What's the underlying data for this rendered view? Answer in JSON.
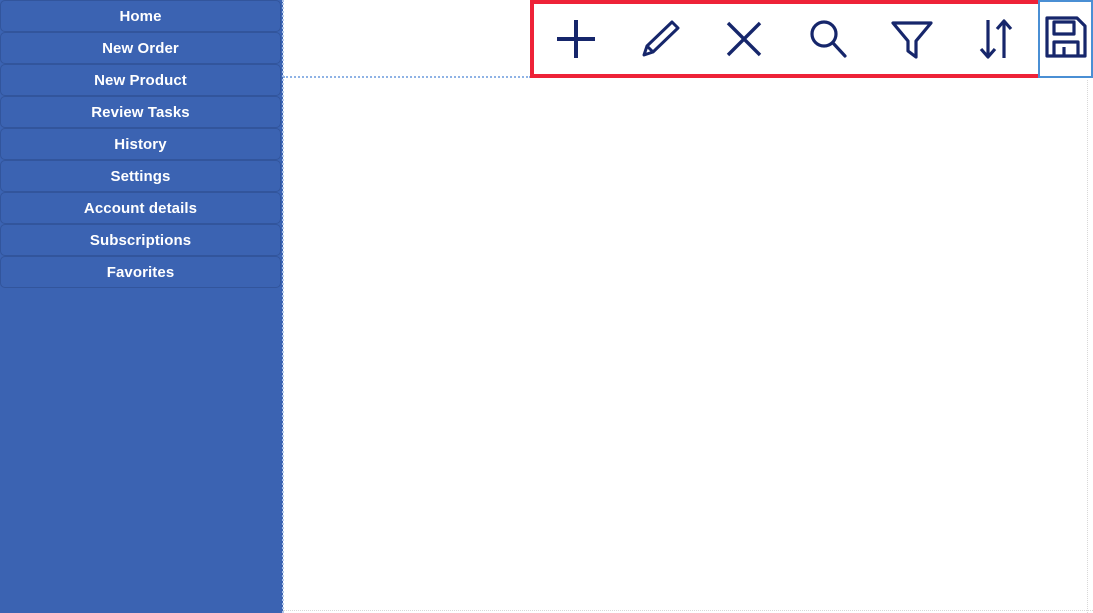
{
  "colors": {
    "sidebar_bg": "#3b63b2",
    "sidebar_item_border": "#32559c",
    "sidebar_text": "#ffffff",
    "toolbar_highlight_border": "#ee2238",
    "icon_color": "#16266b",
    "save_cell_border": "#4a8fd4",
    "guide_line": "#8fb3e5",
    "content_bg": "#ffffff"
  },
  "sidebar": {
    "items": [
      {
        "label": "Home",
        "name": "home"
      },
      {
        "label": "New Order",
        "name": "new-order"
      },
      {
        "label": "New Product",
        "name": "new-product"
      },
      {
        "label": "Review Tasks",
        "name": "review-tasks"
      },
      {
        "label": "History",
        "name": "history"
      },
      {
        "label": "Settings",
        "name": "settings"
      },
      {
        "label": "Account details",
        "name": "account-details"
      },
      {
        "label": "Subscriptions",
        "name": "subscriptions"
      },
      {
        "label": "Favorites",
        "name": "favorites"
      }
    ]
  },
  "toolbar": {
    "buttons": [
      {
        "label": "Add",
        "icon": "plus-icon"
      },
      {
        "label": "Edit",
        "icon": "pencil-icon"
      },
      {
        "label": "Delete",
        "icon": "close-x-icon"
      },
      {
        "label": "Search",
        "icon": "search-icon"
      },
      {
        "label": "Filter",
        "icon": "filter-funnel-icon"
      },
      {
        "label": "Sort",
        "icon": "sort-arrows-icon"
      }
    ],
    "save_button": {
      "label": "Save",
      "icon": "save-floppy-icon"
    }
  }
}
